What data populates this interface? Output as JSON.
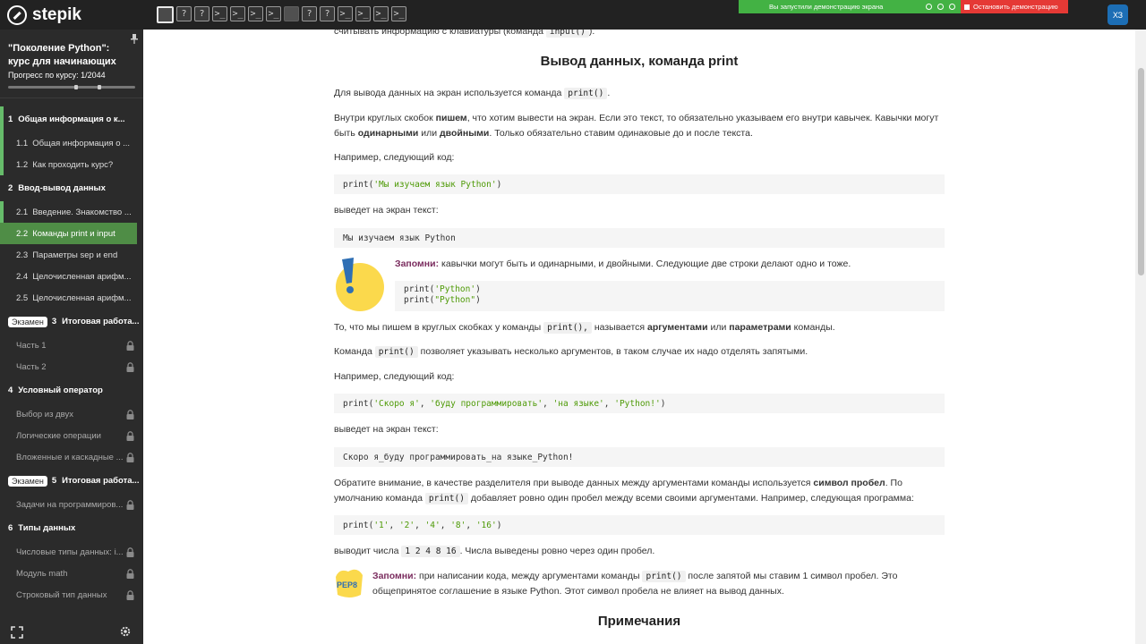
{
  "brand": "stepik",
  "steps": [
    {
      "kind": "active",
      "glyph": ""
    },
    {
      "kind": "question",
      "glyph": "?"
    },
    {
      "kind": "question",
      "glyph": "?"
    },
    {
      "kind": "code",
      "glyph": ">_"
    },
    {
      "kind": "code",
      "glyph": ">_"
    },
    {
      "kind": "code",
      "glyph": ">_"
    },
    {
      "kind": "code",
      "glyph": ">_"
    },
    {
      "kind": "blank",
      "glyph": ""
    },
    {
      "kind": "question",
      "glyph": "?"
    },
    {
      "kind": "question",
      "glyph": "?"
    },
    {
      "kind": "code",
      "glyph": ">_"
    },
    {
      "kind": "code",
      "glyph": ">_"
    },
    {
      "kind": "code",
      "glyph": ">_"
    },
    {
      "kind": "code",
      "glyph": ">_"
    }
  ],
  "screenshare": {
    "status": "Вы запустили демонстрацию экрана",
    "stop": "Остановить демонстрацию"
  },
  "user": {
    "initials": "ХЗ"
  },
  "sidebar": {
    "course_title": "\"Поколение Python\": курс для начинающих",
    "progress_label": "Прогресс по курсу:",
    "progress_value": "1/2044",
    "progress_fraction": 0.0005,
    "rows": [
      {
        "type": "section",
        "num": "1",
        "label": "Общая информация о к...",
        "edge": true
      },
      {
        "type": "item",
        "num": "1.1",
        "label": "Общая информация о ...",
        "edge": true
      },
      {
        "type": "item",
        "num": "1.2",
        "label": "Как проходить курс?",
        "edge": true
      },
      {
        "type": "section",
        "num": "2",
        "label": "Ввод-вывод данных"
      },
      {
        "type": "item",
        "num": "2.1",
        "label": "Введение. Знакомство ...",
        "edge": true
      },
      {
        "type": "item",
        "num": "2.2",
        "label": "Команды print и input",
        "current": true
      },
      {
        "type": "item",
        "num": "2.3",
        "label": "Параметры sep и end"
      },
      {
        "type": "item",
        "num": "2.4",
        "label": "Целочисленная арифм..."
      },
      {
        "type": "item",
        "num": "2.5",
        "label": "Целочисленная арифм..."
      },
      {
        "type": "section",
        "badge": "Экзамен",
        "num": "3",
        "label": "Итоговая работа..."
      },
      {
        "type": "item",
        "label": "Часть 1",
        "locked": true
      },
      {
        "type": "item",
        "label": "Часть 2",
        "locked": true
      },
      {
        "type": "section",
        "num": "4",
        "label": "Условный оператор"
      },
      {
        "type": "item",
        "label": "Выбор из двух",
        "locked": true
      },
      {
        "type": "item",
        "label": "Логические операции",
        "locked": true
      },
      {
        "type": "item",
        "label": "Вложенные и каскадные ...",
        "locked": true
      },
      {
        "type": "section",
        "badge": "Экзамен",
        "num": "5",
        "label": "Итоговая работа..."
      },
      {
        "type": "item",
        "label": "Задачи на программиров...",
        "locked": true
      },
      {
        "type": "section",
        "num": "6",
        "label": "Типы данных"
      },
      {
        "type": "item",
        "label": "Числовые типы данных: i...",
        "locked": true
      },
      {
        "type": "item",
        "label": "Модуль math",
        "locked": true
      },
      {
        "type": "item",
        "label": "Строковый тип данных",
        "locked": true
      }
    ]
  },
  "content": {
    "top_line": {
      "before": "считывать информацию с клавиатуры (команда ",
      "code": "input()",
      "after": ")."
    },
    "heading": "Вывод данных, команда print",
    "p1": {
      "before": "Для вывода данных на экран используется команда ",
      "code": "print()",
      "after": "."
    },
    "p2": {
      "a": "Внутри круглых скобок ",
      "b1": "пишем",
      "b": ", что хотим вывести на экран. Если это текст, то обязательно указываем его внутри кавычек. Кавычки могут быть ",
      "b2": "одинарными",
      "c": " или ",
      "b3": "двойными",
      "d": ". Только обязательно ставим одинаковые до и после текста."
    },
    "p3": "Например, следующий код:",
    "code1": {
      "fn": "print(",
      "str": "'Мы изучаем язык Python'",
      "end": ")"
    },
    "p4": "выведет на экран текст:",
    "out1": "Мы изучаем язык Python",
    "note1": {
      "label": "Запомни:",
      "text": " кавычки могут быть и одинарными, и двойными. Следующие две строки делают одно и тоже."
    },
    "code2": [
      {
        "fn": "print(",
        "str": "'Python'",
        "end": ")"
      },
      {
        "fn": "print(",
        "str": "\"Python\"",
        "end": ")"
      }
    ],
    "p5": {
      "a": "То, что мы пишем в круглых скобках у команды ",
      "code": "print(),",
      "b": " называется ",
      "b1": "аргументами",
      "c": " или ",
      "b2": "параметрами",
      "d": " команды."
    },
    "p6": {
      "a": "Команда ",
      "code": "print()",
      "b": " позволяет указывать несколько аргументов, в таком случае их надо отделять запятыми."
    },
    "p7": "Например, следующий код:",
    "code3": {
      "fn": "print(",
      "args": [
        "'Скоро я'",
        "'буду программировать'",
        "'на языке'",
        "'Python!'"
      ],
      "sep": ", ",
      "end": ")"
    },
    "p8": "выведет на экран текст:",
    "out2": "Скоро я_буду программировать_на языке_Python!",
    "p9": {
      "a": "Обратите внимание, в качестве разделителя при выводе данных между аргументами команды используется ",
      "b1": "символ пробел",
      "b": ". По умолчанию команда ",
      "code": "print()",
      "c": " добавляет ровно один пробел между всеми своими аргументами. Например, следующая программа:"
    },
    "code4": {
      "fn": "print(",
      "args": [
        "'1'",
        "'2'",
        "'4'",
        "'8'",
        "'16'"
      ],
      "sep": ", ",
      "end": ")"
    },
    "p10": {
      "a": "выводит числа ",
      "code": "1 2 4 8 16",
      "b": ". Числа выведены ровно через один пробел."
    },
    "note2": {
      "label": "Запомни:",
      "a": " при написании кода, между аргументами команды ",
      "code": "print()",
      "b": " после запятой мы ставим 1 символ пробел. Это общепринятое соглашение в языке Python. Этот символ пробела не влияет на вывод данных.",
      "sticker": "PEP8"
    },
    "heading2": "Примечания"
  }
}
